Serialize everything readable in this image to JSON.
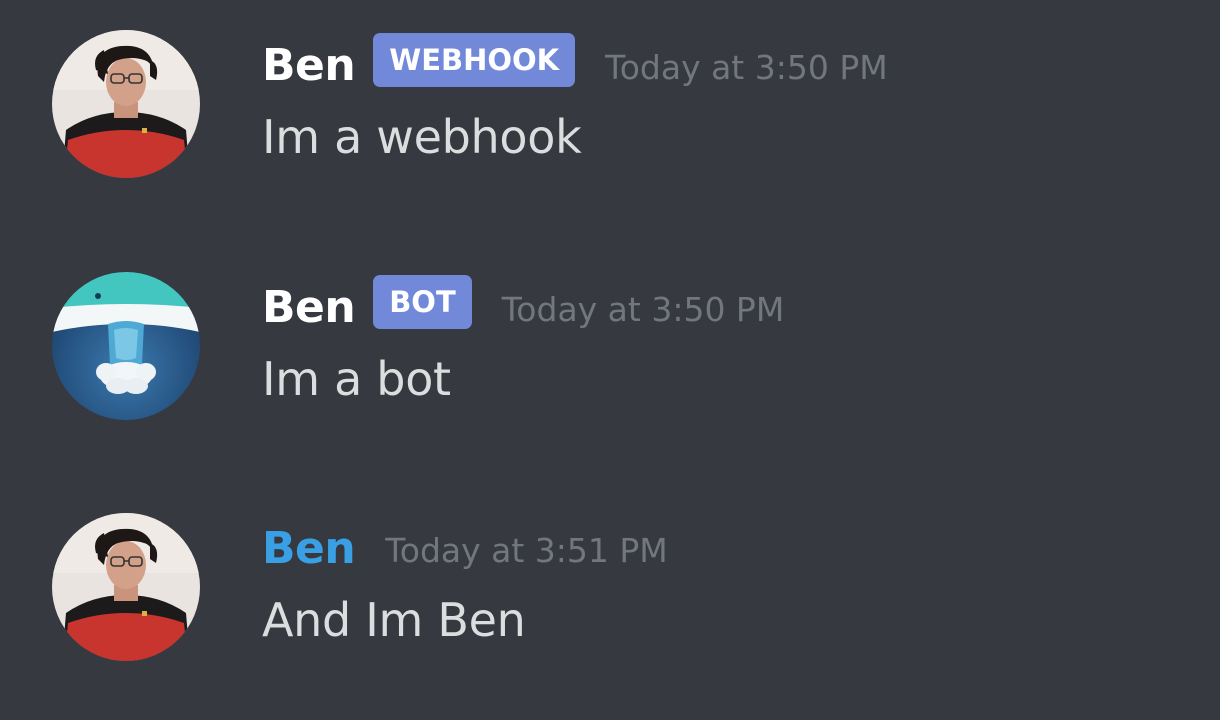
{
  "messages": [
    {
      "author": "Ben",
      "author_color": "#ffffff",
      "badge": "WEBHOOK",
      "timestamp": "Today at 3:50 PM",
      "text": "Im a webhook",
      "avatar": "person-avatar"
    },
    {
      "author": "Ben",
      "author_color": "#ffffff",
      "badge": "BOT",
      "timestamp": "Today at 3:50 PM",
      "text": "Im a bot",
      "avatar": "bot-avatar"
    },
    {
      "author": "Ben",
      "author_color": "#3aa0e6",
      "timestamp": "Today at 3:51 PM",
      "text": "And Im Ben",
      "avatar": "person-avatar"
    }
  ],
  "colors": {
    "background": "#36393f",
    "badge": "#7289da",
    "timestamp": "#72767d",
    "message_text": "#dcddde"
  }
}
